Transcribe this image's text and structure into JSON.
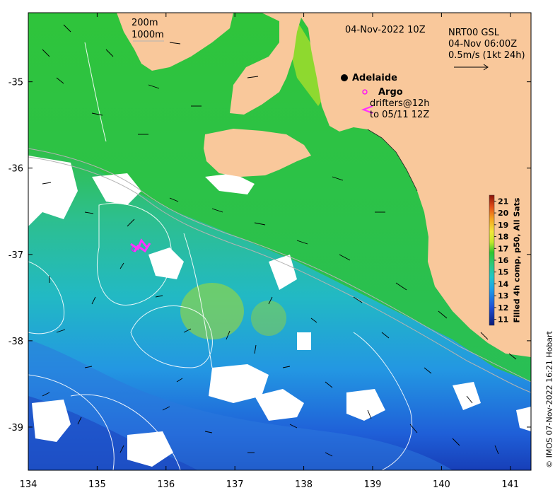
{
  "map": {
    "date_title": "04-Nov-2022 10Z",
    "isobath_legend": [
      "200m",
      "1000m"
    ],
    "current_legend": [
      "NRT00 GSL",
      "04-Nov 06:00Z",
      "0.5m/s (1kt 24h)"
    ],
    "city_label": "Adelaide",
    "argo_label": "Argo",
    "drifters_label": [
      "drifters@12h",
      "to 05/11 12Z"
    ],
    "colorbar_title": "Filled 4h comp, p50, All Sats",
    "colorbar_ticks": [
      "21",
      "20",
      "19",
      "18",
      "17",
      "16",
      "15",
      "14",
      "13",
      "12",
      "11"
    ],
    "colorbar_range": [
      10.5,
      21.5
    ],
    "x_ticks": [
      "134",
      "135",
      "136",
      "137",
      "138",
      "139",
      "140",
      "141"
    ],
    "y_ticks": [
      "-35",
      "-36",
      "-37",
      "-38",
      "-39"
    ],
    "lon_range": [
      134.0,
      141.3
    ],
    "lat_range": [
      -39.5,
      -34.2
    ],
    "credit": "© IMOS 07-Nov-2022 16:21 Hobart",
    "colors": {
      "land": "#f9c89b",
      "no_data": "#ffffff",
      "argo": "#ff00ff",
      "drifter": "#ff33ff"
    }
  }
}
